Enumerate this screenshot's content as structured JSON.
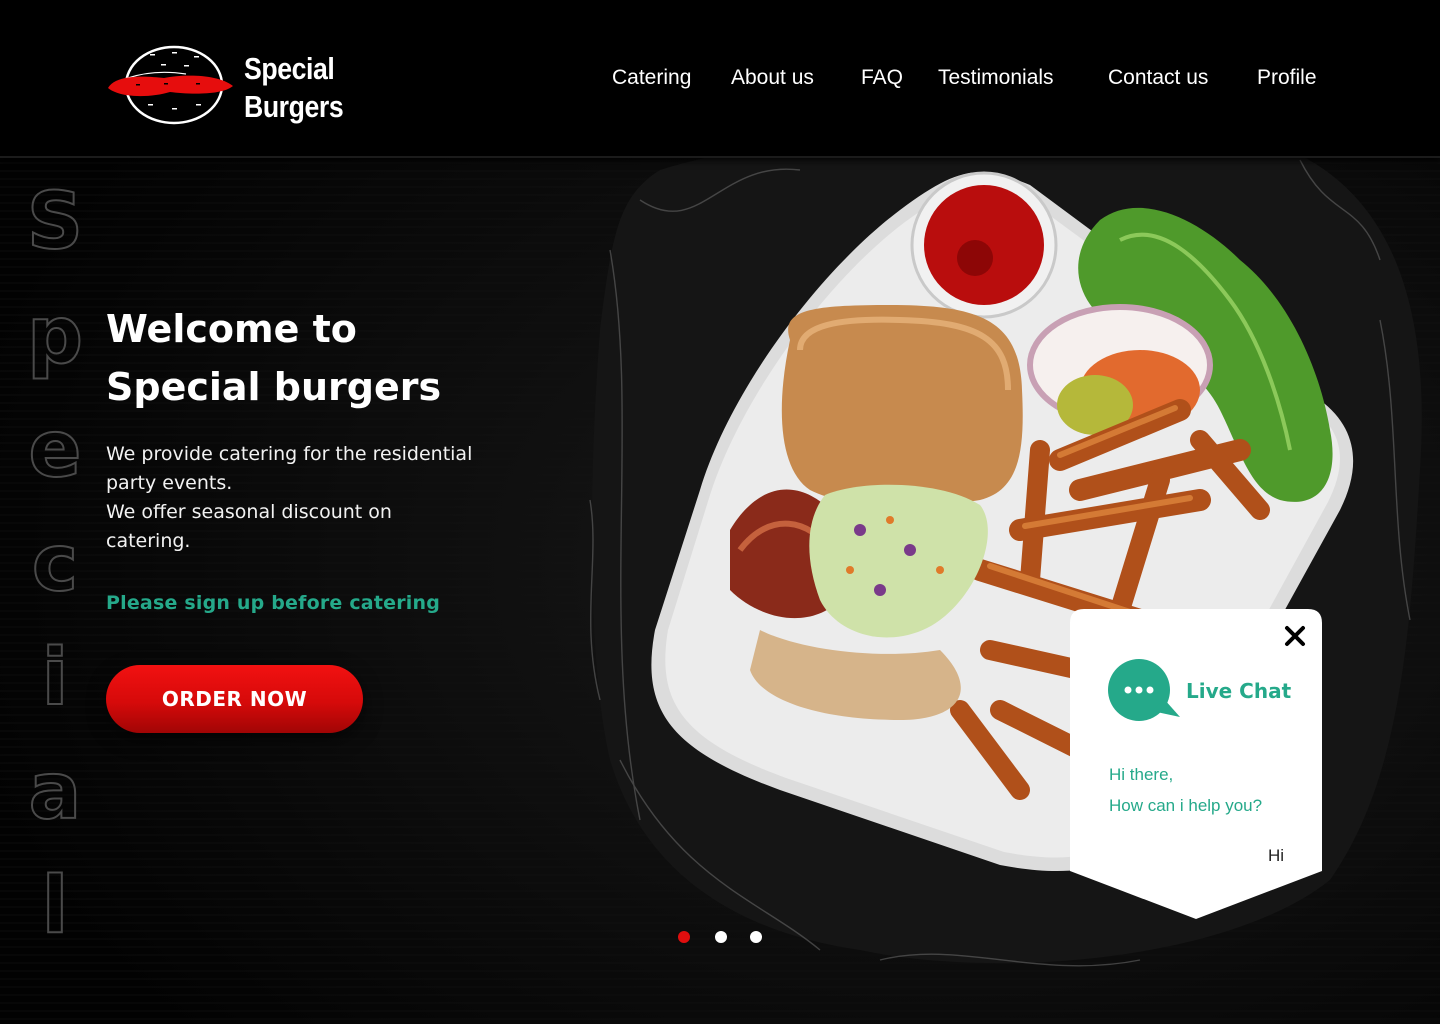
{
  "brand": {
    "name_line1": "Special",
    "name_line2": "Burgers",
    "logo_icon": "burger-icon"
  },
  "nav": {
    "items": [
      {
        "label": "Catering"
      },
      {
        "label": "About us"
      },
      {
        "label": "FAQ"
      },
      {
        "label": "Testimonials"
      },
      {
        "label": "Contact us"
      },
      {
        "label": "Profile"
      }
    ]
  },
  "side_word": {
    "letters": [
      "S",
      "p",
      "e",
      "c",
      "i",
      "a",
      "l"
    ]
  },
  "hero": {
    "title_line1": "Welcome to",
    "title_line2": "Special burgers",
    "desc_line1": "We provide catering for the residential",
    "desc_line2": "party events.",
    "desc_line3": "We offer seasonal discount on",
    "desc_line4": "catering.",
    "note": "Please sign up before catering",
    "cta_label": "ORDER NOW"
  },
  "slider": {
    "count": 3,
    "active_index": 0
  },
  "chat": {
    "title": "Live Chat",
    "message_line1": "Hi there,",
    "message_line2": "How can i help you?",
    "reply": "Hi",
    "close_icon": "close-icon",
    "avatar_icon": "chat-bubble-icon"
  },
  "colors": {
    "accent_red": "#e00e0e",
    "accent_green": "#25a98a",
    "background": "#050505"
  }
}
